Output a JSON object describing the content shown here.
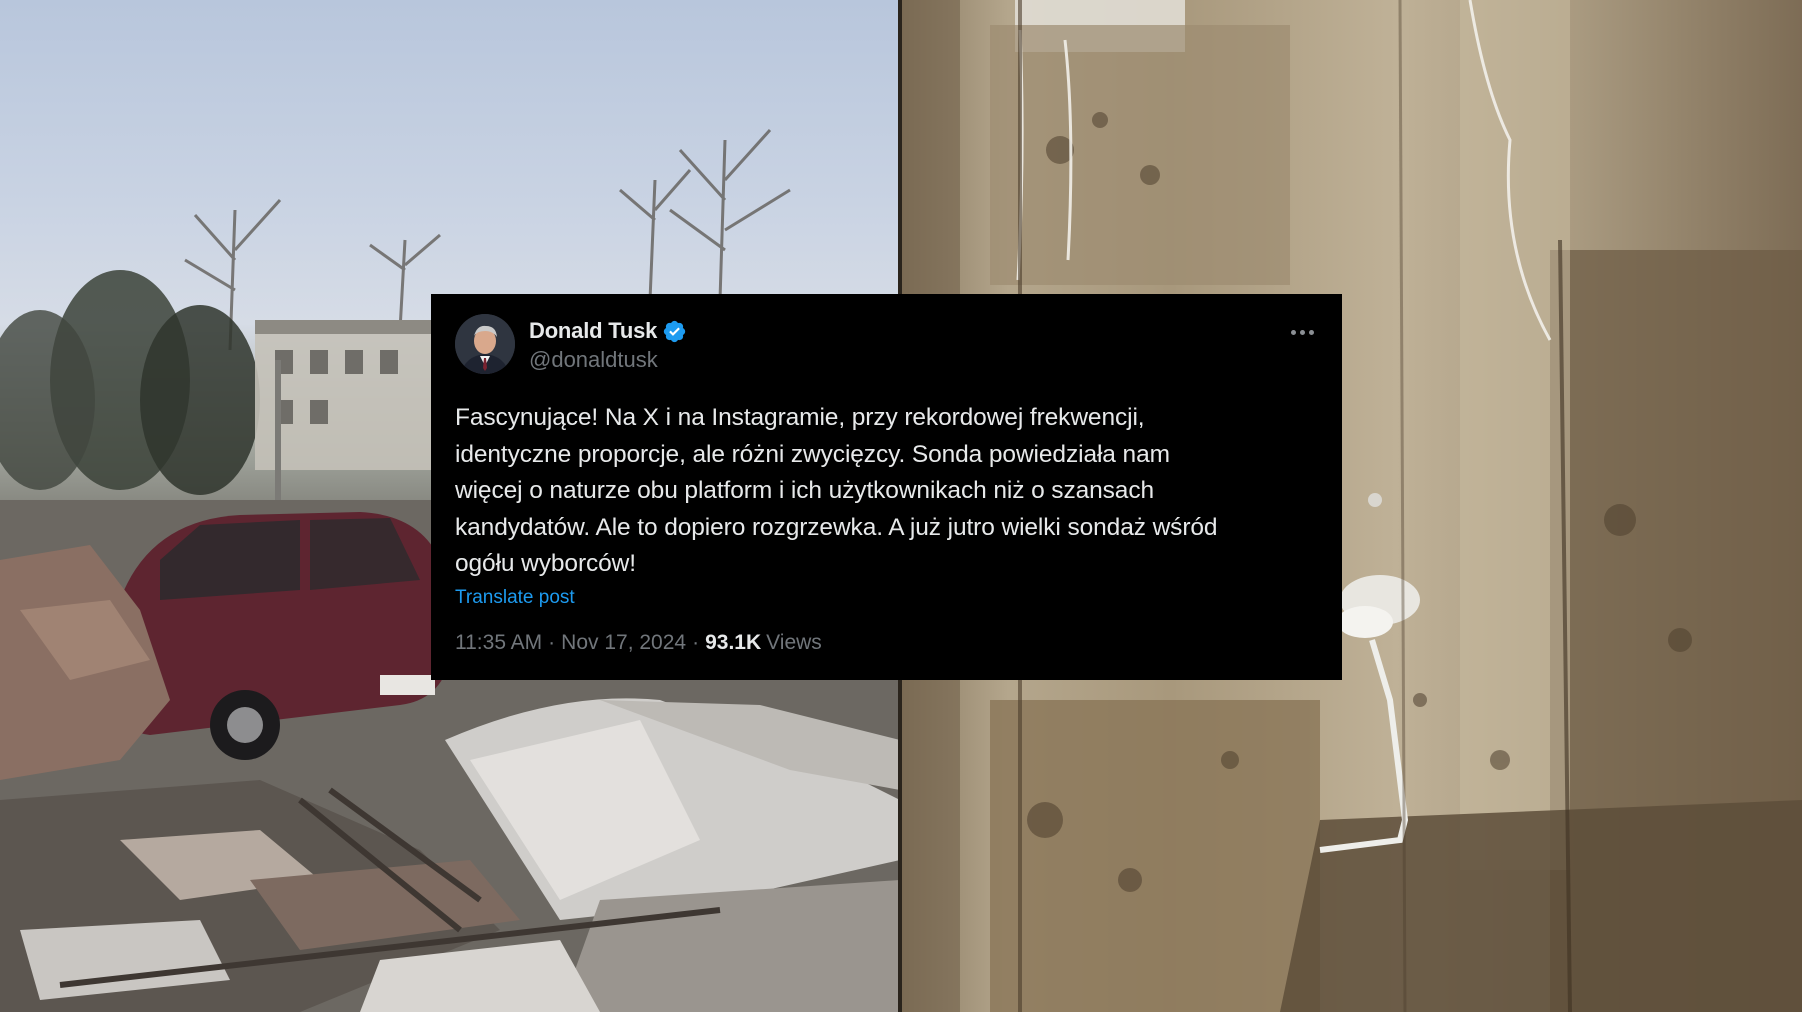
{
  "tweet": {
    "display_name": "Donald Tusk",
    "handle": "@donaldtusk",
    "text": "Fascynujące! Na X i na Instagramie, przy rekordowej frekwencji,\nidentyczne proporcje, ale różni zwycięzcy. Sonda powiedziała nam\nwięcej o naturze obu platform i ich użytkownikach niż o szansach\nkandydatów. Ale to dopiero rozgrzewka. A już jutro wielki sondaż wśród\nogółu wyborców!",
    "translate_label": "Translate post",
    "time": "11:35 AM",
    "separator": "·",
    "date": "Nov 17, 2024",
    "views_count": "93.1K",
    "views_label": "Views",
    "verified_icon": "verified-badge-icon",
    "more_icon": "more-options-icon"
  },
  "colors": {
    "card_background": "#000000",
    "primary_text": "#e7e9ea",
    "secondary_text": "#71767b",
    "link": "#1d9bf0",
    "verified": "#1d9bf0"
  }
}
